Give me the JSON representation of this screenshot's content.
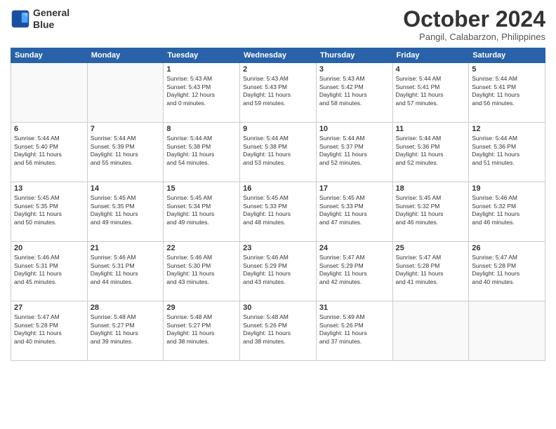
{
  "logo": {
    "line1": "General",
    "line2": "Blue"
  },
  "title": "October 2024",
  "location": "Pangil, Calabarzon, Philippines",
  "weekdays": [
    "Sunday",
    "Monday",
    "Tuesday",
    "Wednesday",
    "Thursday",
    "Friday",
    "Saturday"
  ],
  "weeks": [
    [
      {
        "day": "",
        "info": ""
      },
      {
        "day": "",
        "info": ""
      },
      {
        "day": "1",
        "info": "Sunrise: 5:43 AM\nSunset: 5:43 PM\nDaylight: 12 hours\nand 0 minutes."
      },
      {
        "day": "2",
        "info": "Sunrise: 5:43 AM\nSunset: 5:43 PM\nDaylight: 11 hours\nand 59 minutes."
      },
      {
        "day": "3",
        "info": "Sunrise: 5:43 AM\nSunset: 5:42 PM\nDaylight: 11 hours\nand 58 minutes."
      },
      {
        "day": "4",
        "info": "Sunrise: 5:44 AM\nSunset: 5:41 PM\nDaylight: 11 hours\nand 57 minutes."
      },
      {
        "day": "5",
        "info": "Sunrise: 5:44 AM\nSunset: 5:41 PM\nDaylight: 11 hours\nand 56 minutes."
      }
    ],
    [
      {
        "day": "6",
        "info": "Sunrise: 5:44 AM\nSunset: 5:40 PM\nDaylight: 11 hours\nand 56 minutes."
      },
      {
        "day": "7",
        "info": "Sunrise: 5:44 AM\nSunset: 5:39 PM\nDaylight: 11 hours\nand 55 minutes."
      },
      {
        "day": "8",
        "info": "Sunrise: 5:44 AM\nSunset: 5:38 PM\nDaylight: 11 hours\nand 54 minutes."
      },
      {
        "day": "9",
        "info": "Sunrise: 5:44 AM\nSunset: 5:38 PM\nDaylight: 11 hours\nand 53 minutes."
      },
      {
        "day": "10",
        "info": "Sunrise: 5:44 AM\nSunset: 5:37 PM\nDaylight: 11 hours\nand 52 minutes."
      },
      {
        "day": "11",
        "info": "Sunrise: 5:44 AM\nSunset: 5:36 PM\nDaylight: 11 hours\nand 52 minutes."
      },
      {
        "day": "12",
        "info": "Sunrise: 5:44 AM\nSunset: 5:36 PM\nDaylight: 11 hours\nand 51 minutes."
      }
    ],
    [
      {
        "day": "13",
        "info": "Sunrise: 5:45 AM\nSunset: 5:35 PM\nDaylight: 11 hours\nand 50 minutes."
      },
      {
        "day": "14",
        "info": "Sunrise: 5:45 AM\nSunset: 5:35 PM\nDaylight: 11 hours\nand 49 minutes."
      },
      {
        "day": "15",
        "info": "Sunrise: 5:45 AM\nSunset: 5:34 PM\nDaylight: 11 hours\nand 49 minutes."
      },
      {
        "day": "16",
        "info": "Sunrise: 5:45 AM\nSunset: 5:33 PM\nDaylight: 11 hours\nand 48 minutes."
      },
      {
        "day": "17",
        "info": "Sunrise: 5:45 AM\nSunset: 5:33 PM\nDaylight: 11 hours\nand 47 minutes."
      },
      {
        "day": "18",
        "info": "Sunrise: 5:45 AM\nSunset: 5:32 PM\nDaylight: 11 hours\nand 46 minutes."
      },
      {
        "day": "19",
        "info": "Sunrise: 5:46 AM\nSunset: 5:32 PM\nDaylight: 11 hours\nand 46 minutes."
      }
    ],
    [
      {
        "day": "20",
        "info": "Sunrise: 5:46 AM\nSunset: 5:31 PM\nDaylight: 11 hours\nand 45 minutes."
      },
      {
        "day": "21",
        "info": "Sunrise: 5:46 AM\nSunset: 5:31 PM\nDaylight: 11 hours\nand 44 minutes."
      },
      {
        "day": "22",
        "info": "Sunrise: 5:46 AM\nSunset: 5:30 PM\nDaylight: 11 hours\nand 43 minutes."
      },
      {
        "day": "23",
        "info": "Sunrise: 5:46 AM\nSunset: 5:29 PM\nDaylight: 11 hours\nand 43 minutes."
      },
      {
        "day": "24",
        "info": "Sunrise: 5:47 AM\nSunset: 5:29 PM\nDaylight: 11 hours\nand 42 minutes."
      },
      {
        "day": "25",
        "info": "Sunrise: 5:47 AM\nSunset: 5:28 PM\nDaylight: 11 hours\nand 41 minutes."
      },
      {
        "day": "26",
        "info": "Sunrise: 5:47 AM\nSunset: 5:28 PM\nDaylight: 11 hours\nand 40 minutes."
      }
    ],
    [
      {
        "day": "27",
        "info": "Sunrise: 5:47 AM\nSunset: 5:28 PM\nDaylight: 11 hours\nand 40 minutes."
      },
      {
        "day": "28",
        "info": "Sunrise: 5:48 AM\nSunset: 5:27 PM\nDaylight: 11 hours\nand 39 minutes."
      },
      {
        "day": "29",
        "info": "Sunrise: 5:48 AM\nSunset: 5:27 PM\nDaylight: 11 hours\nand 38 minutes."
      },
      {
        "day": "30",
        "info": "Sunrise: 5:48 AM\nSunset: 5:26 PM\nDaylight: 11 hours\nand 38 minutes."
      },
      {
        "day": "31",
        "info": "Sunrise: 5:49 AM\nSunset: 5:26 PM\nDaylight: 11 hours\nand 37 minutes."
      },
      {
        "day": "",
        "info": ""
      },
      {
        "day": "",
        "info": ""
      }
    ]
  ]
}
